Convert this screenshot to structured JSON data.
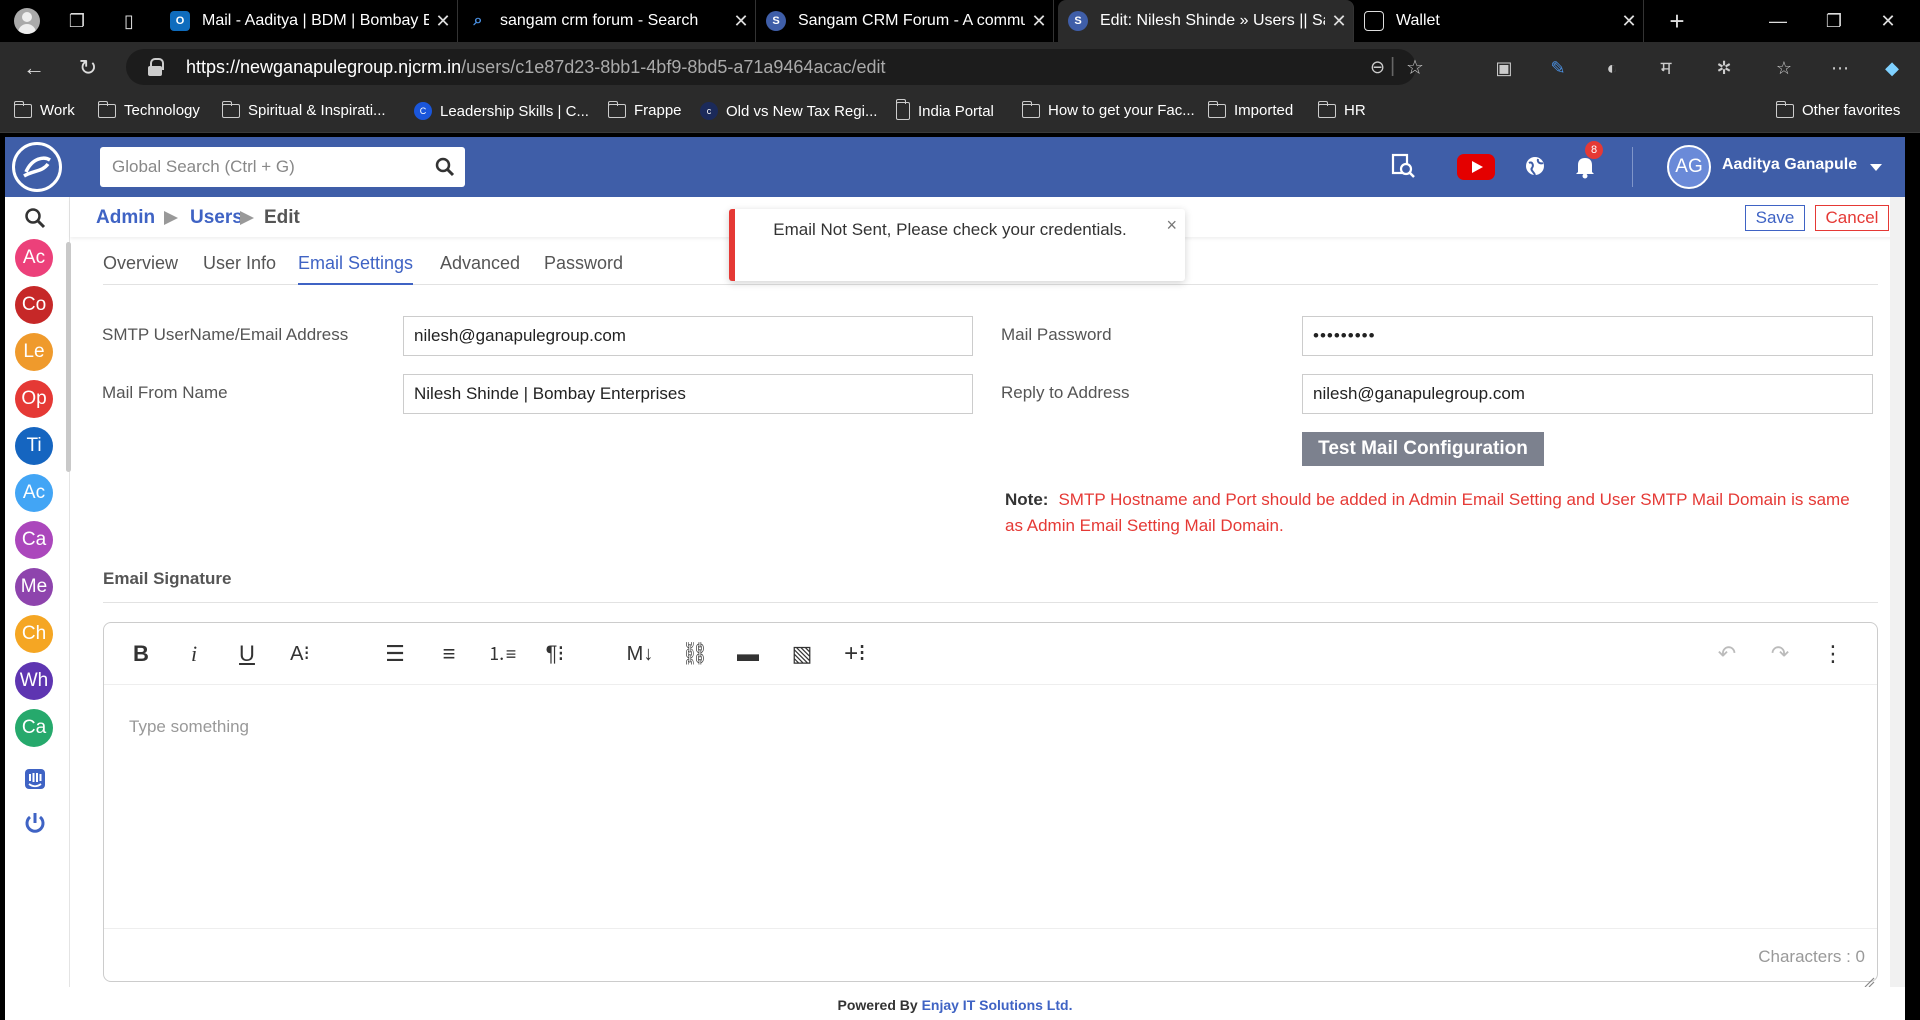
{
  "browser": {
    "tabs": [
      {
        "label": "Mail - Aaditya | BDM | Bombay En",
        "color": "#0f6cbd",
        "icon": "outlook-icon"
      },
      {
        "label": "sangam crm forum - Search",
        "color": "#1a73e8",
        "icon": "search-icon"
      },
      {
        "label": "Sangam CRM Forum - A commun",
        "color": "#3f5ea8",
        "icon": "sangam-icon"
      },
      {
        "label": "Edit: Nilesh Shinde » Users || Sang",
        "color": "#3f5ea8",
        "icon": "sangam-icon"
      },
      {
        "label": "Wallet",
        "color": "#555",
        "icon": "wallet-icon"
      }
    ],
    "url_host": "https://newganapulegroup.njcrm.in",
    "url_path": "/users/c1e87d23-8bb1-4bf9-8bd5-a71a9464acac/edit",
    "bookmarks": [
      "Work",
      "Technology",
      "Spiritual & Inspirati...",
      "Leadership Skills | C...",
      "Frappe",
      "Old vs New Tax Regi...",
      "India Portal",
      "How to get your Fac...",
      "Imported",
      "HR"
    ],
    "other_favorites": "Other favorites"
  },
  "app": {
    "search_placeholder": "Global Search (Ctrl + G)",
    "bell_count": "8",
    "user_initials": "AG",
    "user_name": "Aaditya Ganapule",
    "sidebar": [
      {
        "label": "Ac",
        "color": "#ec407a"
      },
      {
        "label": "Co",
        "color": "#c62828"
      },
      {
        "label": "Le",
        "color": "#ef9a2c"
      },
      {
        "label": "Op",
        "color": "#e53935"
      },
      {
        "label": "Ti",
        "color": "#1565c0"
      },
      {
        "label": "Ac",
        "color": "#42a5f5"
      },
      {
        "label": "Ca",
        "color": "#ab47bc"
      },
      {
        "label": "Me",
        "color": "#8e44ad"
      },
      {
        "label": "Ch",
        "color": "#f5a623"
      },
      {
        "label": "Wh",
        "color": "#5e35b1"
      },
      {
        "label": "Ca",
        "color": "#26a96c"
      }
    ],
    "breadcrumb": {
      "admin": "Admin",
      "users": "Users",
      "current": "Edit"
    },
    "save_label": "Save",
    "cancel_label": "Cancel",
    "toast_message": "Email Not Sent, Please check your credentials.",
    "tabs": [
      "Overview",
      "User Info",
      "Email Settings",
      "Advanced",
      "Password"
    ],
    "active_tab": "Email Settings",
    "form": {
      "smtp_label": "SMTP UserName/Email Address",
      "smtp_value": "nilesh@ganapulegroup.com",
      "mail_password_label": "Mail Password",
      "mail_password_value": "•••••••••",
      "from_name_label": "Mail From Name",
      "from_name_value": "Nilesh Shinde | Bombay Enterprises",
      "reply_to_label": "Reply to Address",
      "reply_to_value": "nilesh@ganapulegroup.com",
      "test_button": "Test Mail Configuration",
      "note_label": "Note:",
      "note_text": "SMTP Hostname and Port should be added in Admin Email Setting and User SMTP Mail Domain is same as Admin Email Setting Mail Domain."
    },
    "signature": {
      "title": "Email Signature",
      "placeholder": "Type something",
      "characters": "Characters : 0"
    },
    "footer": {
      "prefix": "Powered By",
      "company": "Enjay IT Solutions Ltd."
    }
  }
}
